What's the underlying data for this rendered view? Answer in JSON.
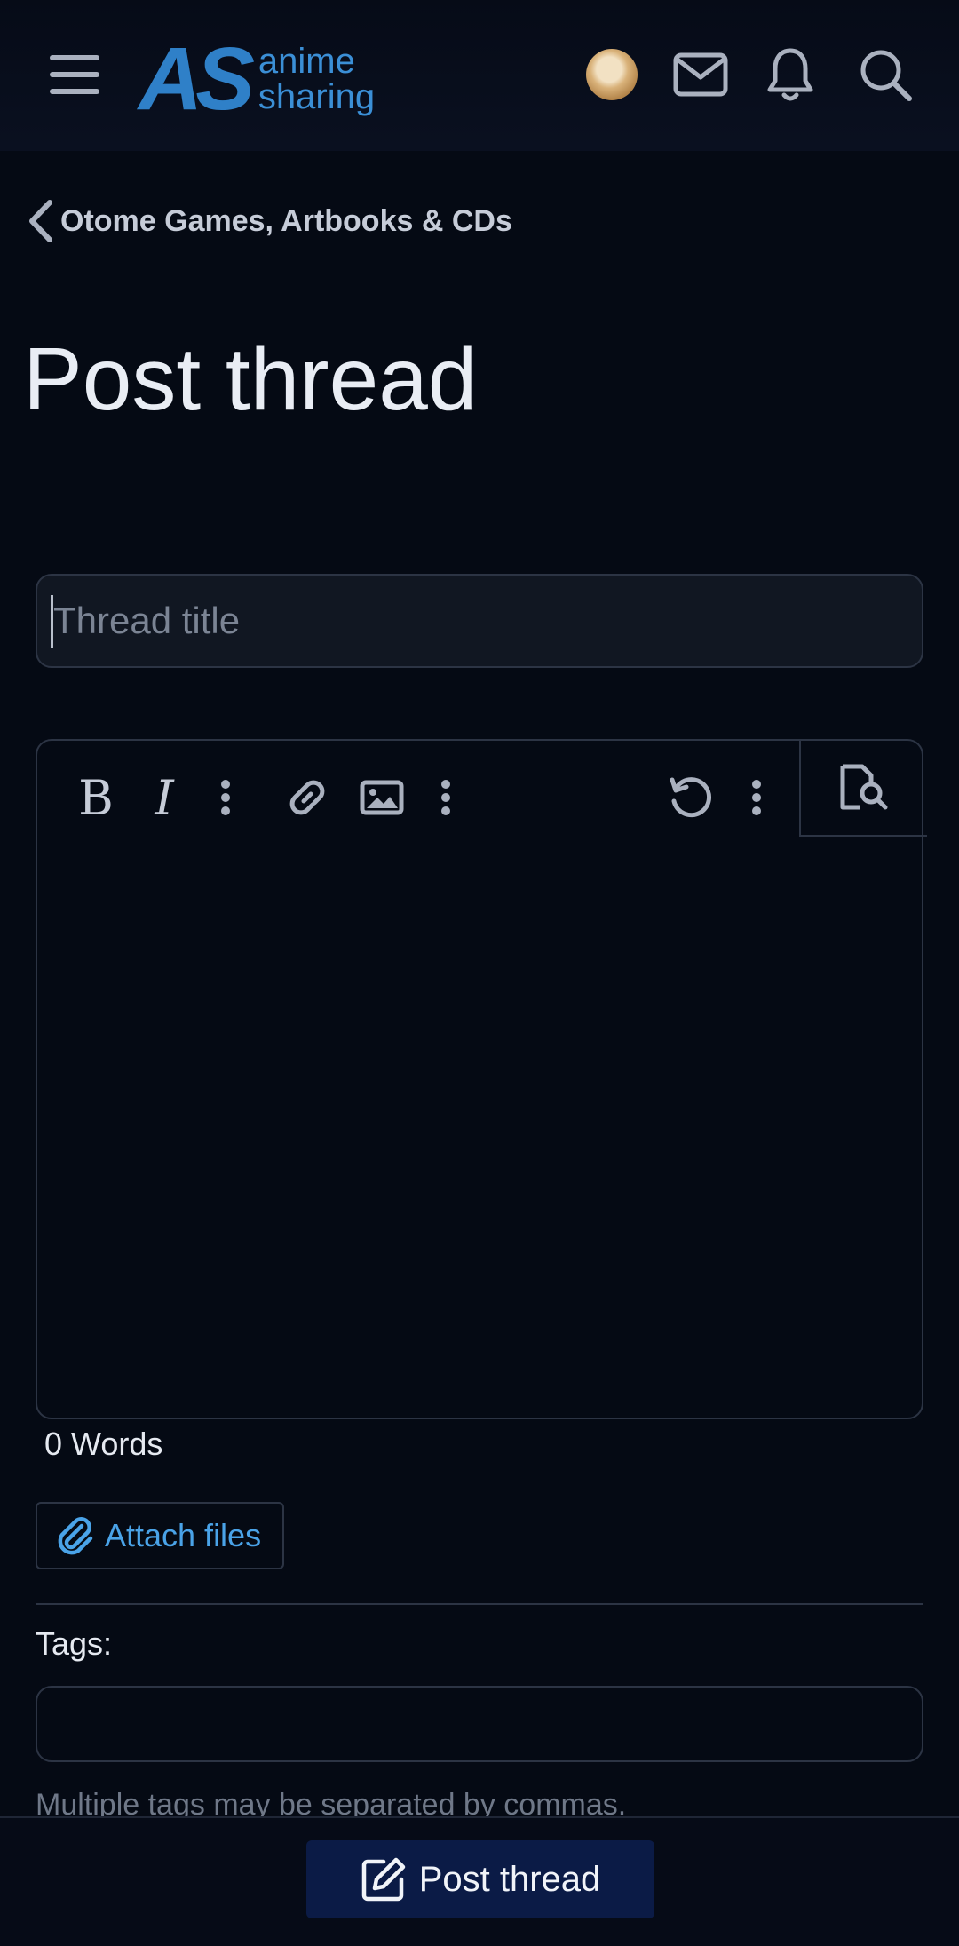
{
  "header": {
    "logo_mark": "AS",
    "logo_line1": "anime",
    "logo_line2": "sharing",
    "icons": [
      "menu-icon",
      "avatar",
      "mail-icon",
      "bell-icon",
      "search-icon"
    ]
  },
  "breadcrumb": {
    "label": "Otome Games, Artbooks & CDs"
  },
  "page": {
    "title": "Post thread"
  },
  "form": {
    "title_placeholder": "Thread title",
    "title_value": "",
    "toolbar": {
      "bold_label": "B",
      "italic_label": "I",
      "icons": [
        "bold-icon",
        "italic-icon",
        "more-text-options-icon",
        "link-icon",
        "image-icon",
        "more-insert-options-icon",
        "undo-icon",
        "more-options-icon",
        "preview-icon"
      ]
    },
    "word_count": "0 Words",
    "attach_label": "Attach files",
    "tags_label": "Tags:",
    "tags_value": "",
    "tags_hint": "Multiple tags may be separated by commas.",
    "submit_label": "Post thread"
  },
  "colors": {
    "background": "#050a14",
    "accent": "#3b8fd6",
    "button": "#0b1b46",
    "border": "#2c3444"
  }
}
